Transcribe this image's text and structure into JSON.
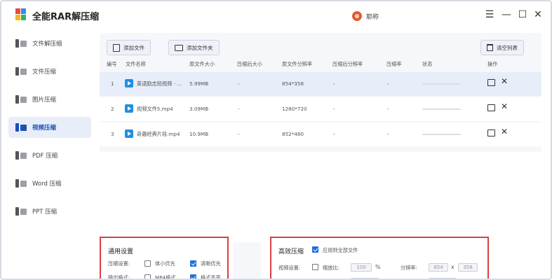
{
  "window": {
    "title": "全能RAR解压缩",
    "user_name": "耶称",
    "controls": {
      "menu": "☰",
      "minimize": "—",
      "maximize": "☐",
      "close": "✕"
    }
  },
  "colors": {
    "accent": "#1a4fb5",
    "selected_row": "#e7eef9",
    "panel_border": "#d94040",
    "video_icon": "#1e90e0"
  },
  "sidebar": {
    "items": [
      {
        "label": "文件解压缩",
        "icon": "file-unzip-icon",
        "active": false
      },
      {
        "label": "文件压缩",
        "icon": "file-zip-icon",
        "active": false
      },
      {
        "label": "图片压缩",
        "icon": "image-icon",
        "active": false
      },
      {
        "label": "视频压缩",
        "icon": "video-icon",
        "active": true
      },
      {
        "label": "PDF 压缩",
        "icon": "pdf-icon",
        "active": false
      },
      {
        "label": "Word 压缩",
        "icon": "word-icon",
        "active": false
      },
      {
        "label": "PPT 压缩",
        "icon": "ppt-icon",
        "active": false
      }
    ]
  },
  "toolbar": {
    "add_file": "添加文件",
    "add_folder": "添加文件夹",
    "clear_list": "清空列表"
  },
  "table": {
    "columns": [
      "编号",
      "文件名称",
      "原文件大小",
      "压缩后大小",
      "原文件分辨率",
      "压缩后分辨率",
      "压缩率",
      "状态",
      "操作"
    ],
    "rows": [
      {
        "index": "1",
        "name": "英语励志短视频 - ...",
        "size": "5.99MB",
        "compressed_size": "-",
        "resolution": "854*358",
        "compressed_resolution": "-",
        "ratio": "-",
        "selected": true
      },
      {
        "index": "2",
        "name": "视频文件5.mp4",
        "size": "3.09MB",
        "compressed_size": "-",
        "resolution": "1280*720",
        "compressed_resolution": "-",
        "ratio": "-",
        "selected": false
      },
      {
        "index": "3",
        "name": "奇趣经典片段.mp4",
        "size": "10.9MB",
        "compressed_size": "-",
        "resolution": "852*480",
        "compressed_resolution": "-",
        "ratio": "-",
        "selected": false
      }
    ]
  },
  "general_settings": {
    "title": "通用设置",
    "compress_label": "压缩设置:",
    "opt_small": "体小优先",
    "opt_clear": "清晰优先",
    "output_label": "输出格式:",
    "opt_mp4": "MP4格式",
    "opt_keep": "格式不变"
  },
  "efficient": {
    "title": "高效压缩",
    "apply_all": "应用到全部文件",
    "video_label": "视频设置:",
    "scale_label": "缩放比:",
    "scale_value": "100",
    "scale_unit": "%",
    "resolution_label": "分辨率:",
    "res_w": "854",
    "res_x": "x",
    "res_h": "358"
  }
}
